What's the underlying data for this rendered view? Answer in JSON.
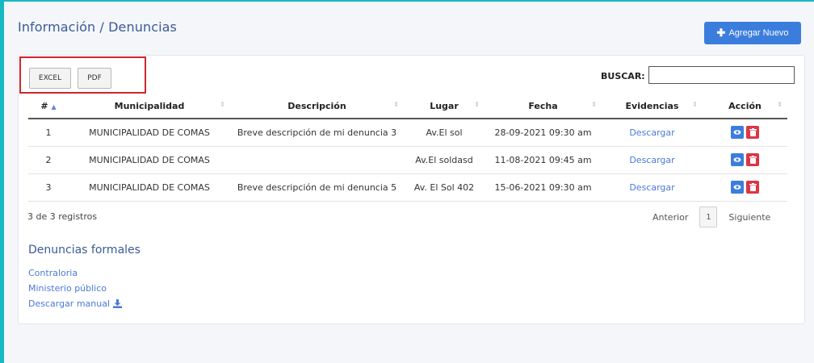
{
  "page": {
    "title": "Información / Denuncias"
  },
  "toolbar": {
    "add_label": "Agregar Nuevo",
    "add_icon": "plus-icon"
  },
  "export": {
    "excel_label": "EXCEL",
    "pdf_label": "PDF"
  },
  "search": {
    "label": "BUSCAR:",
    "value": "",
    "placeholder": ""
  },
  "table": {
    "columns": [
      "#",
      "Municipalidad",
      "Descripción",
      "Lugar",
      "Fecha",
      "Evidencias",
      "Acción"
    ],
    "rows": [
      {
        "num": "1",
        "municipalidad": "MUNICIPALIDAD DE COMAS",
        "descripcion": "Breve descripción de mi denuncia 3",
        "lugar": "Av.El sol",
        "fecha": "28-09-2021 09:30 am",
        "evidencia": "Descargar"
      },
      {
        "num": "2",
        "municipalidad": "MUNICIPALIDAD DE COMAS",
        "descripcion": "",
        "lugar": "Av.El soldasd",
        "fecha": "11-08-2021 09:45 am",
        "evidencia": "Descargar"
      },
      {
        "num": "3",
        "municipalidad": "MUNICIPALIDAD DE COMAS",
        "descripcion": "Breve descripción de mi denuncia 5",
        "lugar": "Av. El Sol 402",
        "fecha": "15-06-2021 09:30 am",
        "evidencia": "Descargar"
      }
    ]
  },
  "footer": {
    "count": "3 de 3 registros",
    "prev": "Anterior",
    "page": "1",
    "next": "Siguiente"
  },
  "formal": {
    "title": "Denuncias formales",
    "links": [
      "Contraloria",
      "Ministerio público",
      "Descargar manual"
    ]
  },
  "colors": {
    "accent": "#3b7ddd",
    "danger": "#dc3545",
    "highlight_border": "#d0262e",
    "frame_border": "#16b8c4"
  }
}
